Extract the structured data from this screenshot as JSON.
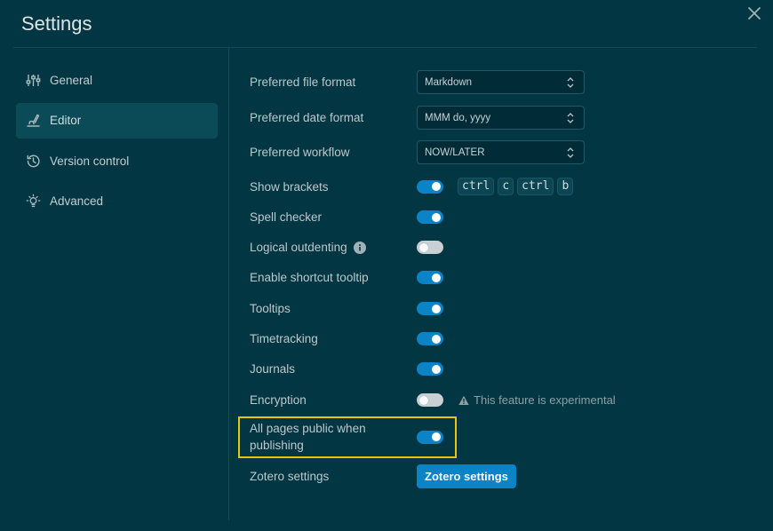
{
  "header": {
    "title": "Settings"
  },
  "sidebar": {
    "items": [
      {
        "label": "General",
        "icon": "sliders-icon",
        "active": false
      },
      {
        "label": "Editor",
        "icon": "pen-icon",
        "active": true
      },
      {
        "label": "Version control",
        "icon": "history-icon",
        "active": false
      },
      {
        "label": "Advanced",
        "icon": "bulb-icon",
        "active": false
      }
    ]
  },
  "settings": {
    "file_format": {
      "label": "Preferred file format",
      "value": "Markdown"
    },
    "date_format": {
      "label": "Preferred date format",
      "value": "MMM do, yyyy"
    },
    "workflow": {
      "label": "Preferred workflow",
      "value": "NOW/LATER"
    },
    "show_brackets": {
      "label": "Show brackets",
      "on": true,
      "shortcut": [
        "ctrl",
        "c",
        "ctrl",
        "b"
      ]
    },
    "spell_checker": {
      "label": "Spell checker",
      "on": true
    },
    "logical_outdenting": {
      "label": "Logical outdenting",
      "on": false
    },
    "shortcut_tooltip": {
      "label": "Enable shortcut tooltip",
      "on": true
    },
    "tooltips": {
      "label": "Tooltips",
      "on": true
    },
    "timetracking": {
      "label": "Timetracking",
      "on": true
    },
    "journals": {
      "label": "Journals",
      "on": true
    },
    "encryption": {
      "label": "Encryption",
      "on": false,
      "warning": "This feature is experimental"
    },
    "public_pages": {
      "label": "All pages public when publishing",
      "on": true
    },
    "zotero": {
      "label": "Zotero settings",
      "button_label": "Zotero settings"
    }
  },
  "colors": {
    "background": "#023643",
    "accent": "#0a84c6",
    "highlight": "#e8c40e"
  }
}
